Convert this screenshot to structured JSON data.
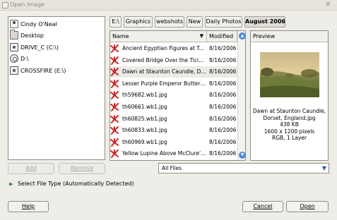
{
  "window": {
    "title": "Open Image",
    "close_glyph": "✕"
  },
  "places": [
    {
      "label": "Cindy O'Neal",
      "icon": "user-icon"
    },
    {
      "label": "Desktop",
      "icon": "desktop-folder-icon"
    },
    {
      "label": "DRIVE_C (C:\\)",
      "icon": "hard-drive-icon"
    },
    {
      "label": "D:\\",
      "icon": "cd-drive-icon"
    },
    {
      "label": "CROSSFIRE (E:\\)",
      "icon": "hard-drive-icon"
    }
  ],
  "breadcrumb": {
    "scroll_left": "◂",
    "items": [
      "E:\\",
      "Graphics",
      "webshots",
      "New",
      "Daily Photos",
      "August 2006"
    ],
    "active_index": 5
  },
  "file_list": {
    "columns": {
      "name": "Name",
      "modified": "Modified",
      "sort_glyph": "▼"
    },
    "rows": [
      {
        "name": "Ancient Egyptian Figures at Tem...",
        "modified": "8/16/2006"
      },
      {
        "name": "Covered Bridge Over the Ticino ...",
        "modified": "8/16/2006"
      },
      {
        "name": "Dawn at Staunton Caundle, Dor...",
        "modified": "8/16/2006"
      },
      {
        "name": "Lesser Purple Emperor Butterfly...",
        "modified": "8/16/2006"
      },
      {
        "name": "th59682.wb1.jpg",
        "modified": "8/16/2006"
      },
      {
        "name": "th60661.wb1.jpg",
        "modified": "8/16/2006"
      },
      {
        "name": "th60825.wb1.jpg",
        "modified": "8/16/2006"
      },
      {
        "name": "th60833.wb1.jpg",
        "modified": "8/16/2006"
      },
      {
        "name": "th60969.wb1.jpg",
        "modified": "8/16/2006"
      },
      {
        "name": "Yellow Lupine Above McClure's B...",
        "modified": "8/16/2006"
      }
    ],
    "selected_index": 2,
    "scroll_up": "▲",
    "scroll_down": "▼"
  },
  "preview": {
    "header": "Preview",
    "info_lines": [
      "Dawn at Staunton Caundle,",
      "Dorset, England.jpg",
      "438 KB",
      "1600 x 1200 pixels",
      "RGB, 1 Layer"
    ]
  },
  "buttons": {
    "add": "Add",
    "remove": "Remove",
    "help": "Help",
    "cancel": "Cancel",
    "open": "Open"
  },
  "filter": {
    "value": "All Files",
    "dropdown_glyph": "▼"
  },
  "file_type": {
    "expander_glyph": "▶",
    "label": "Select File Type (Automatically Detected)"
  },
  "colors": {
    "file_icon": "#cc2a2a",
    "scroll_accent": "#4c86d6",
    "expander": "#2a8a2a"
  }
}
